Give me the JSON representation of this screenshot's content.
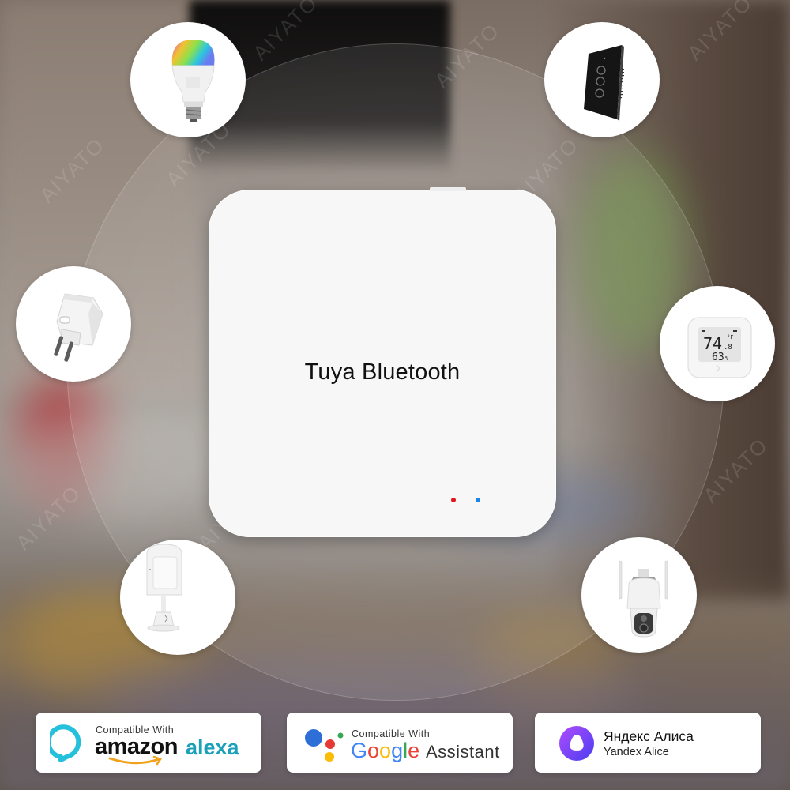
{
  "watermark": "AIYATO",
  "hub": {
    "label": "Tuya Bluetooth",
    "led_colors": {
      "red": "#e0161b",
      "blue": "#1a86e5"
    }
  },
  "devices": [
    {
      "id": "bulb",
      "name": "RGB smart bulb",
      "icon": "rgb-bulb-icon"
    },
    {
      "id": "switch",
      "name": "Smart wall switch (3-gang, black glass)",
      "icon": "wall-switch-icon"
    },
    {
      "id": "plug",
      "name": "Smart plug (EU)",
      "icon": "smart-plug-icon"
    },
    {
      "id": "sensor",
      "name": "Temperature & humidity sensor",
      "icon": "thermo-hygrometer-icon",
      "display": {
        "temperature": "74",
        "temperature_decimal": ".8",
        "temperature_unit": "°F",
        "humidity": "63",
        "humidity_unit": "%"
      }
    },
    {
      "id": "pir",
      "name": "PIR motion sensor",
      "icon": "motion-sensor-icon"
    },
    {
      "id": "camera",
      "name": "Outdoor PTZ camera",
      "icon": "security-camera-icon"
    }
  ],
  "badges": {
    "alexa": {
      "compatible_label": "Compatible  With",
      "brand": "amazon",
      "product": "alexa",
      "colors": {
        "ring": "#25c0dc",
        "product": "#1aa0b8",
        "smile": "#f0a21c"
      }
    },
    "google": {
      "compatible_label": "Compatible  With",
      "brand_letters": [
        "G",
        "o",
        "o",
        "g",
        "l",
        "e"
      ],
      "brand_colors": [
        "#4285f4",
        "#ea4335",
        "#fbbc05",
        "#4285f4",
        "#34a853",
        "#ea4335"
      ],
      "product": "Assistant"
    },
    "yandex": {
      "title_ru": "Яндекс Алиса",
      "title_en": "Yandex Alice",
      "icon_colors": [
        "#8a3ffc",
        "#5a3cf0"
      ]
    }
  }
}
